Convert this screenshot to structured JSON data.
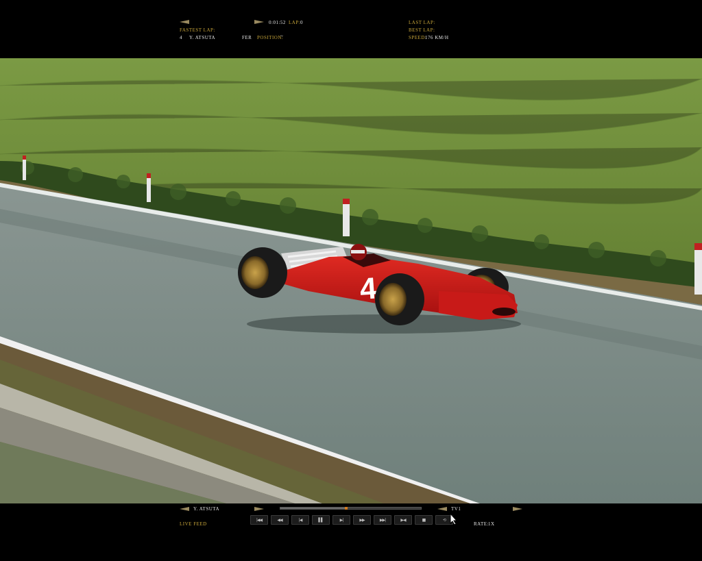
{
  "hud_top": {
    "fastest_lap_label": "Fastest Lap:",
    "driver_number": "4",
    "driver_name": "Y. Atsuta",
    "team": "FER",
    "position_label": "Position:",
    "position_value": "~",
    "session_time": "0:01:52",
    "lap_label": "Lap:",
    "lap_value": "0",
    "last_lap_label": "Last Lap:",
    "best_lap_label": "Best Lap:",
    "speed_label": "Speed:",
    "speed_value": "176 km/h"
  },
  "car": {
    "number": "4",
    "body_color": "#d01818"
  },
  "hud_bottom": {
    "selected_driver": "Y. Atsuta",
    "feed_label": "Live Feed",
    "camera": "TV1",
    "rate_label": "Rate:",
    "rate_value": "1x",
    "replay_progress": 0.47,
    "controls": [
      {
        "name": "skip-to-start-button",
        "glyph": "|◀◀"
      },
      {
        "name": "rewind-button",
        "glyph": "◀◀"
      },
      {
        "name": "step-back-button",
        "glyph": "|◀"
      },
      {
        "name": "pause-button",
        "glyph": "▌▌"
      },
      {
        "name": "step-forward-button",
        "glyph": "▶|"
      },
      {
        "name": "fast-forward-button",
        "glyph": "▶▶"
      },
      {
        "name": "skip-to-end-button",
        "glyph": "▶▶|"
      },
      {
        "name": "slow-motion-button",
        "glyph": "▶◀"
      },
      {
        "name": "stop-button",
        "glyph": "■"
      },
      {
        "name": "loop-button",
        "glyph": "⟲"
      }
    ]
  },
  "colors": {
    "hud_gold": "#c8a63a",
    "grass": "#6f8f3a",
    "asphalt": "#7b8b87",
    "hedge": "#2f4a1d"
  }
}
